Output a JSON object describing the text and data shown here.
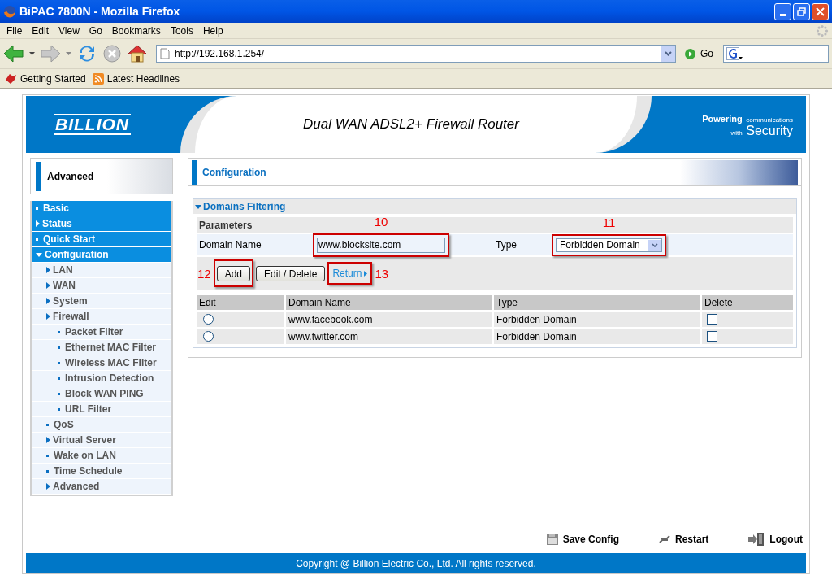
{
  "window": {
    "title": "BiPAC 7800N - Mozilla Firefox"
  },
  "menu": [
    "File",
    "Edit",
    "View",
    "Go",
    "Bookmarks",
    "Tools",
    "Help"
  ],
  "toolbar": {
    "address": "http://192.168.1.254/",
    "go": "Go"
  },
  "bookmarks": [
    "Getting Started",
    "Latest Headlines"
  ],
  "header": {
    "logo": "BILLION",
    "product": "Dual WAN ADSL2+ Firewall Router",
    "tagline_top": "Powering",
    "tagline_small": "communications",
    "tagline_with": "with",
    "tagline_big": "Security"
  },
  "sidebar": {
    "title": "Advanced",
    "items": [
      {
        "label": "Basic",
        "kind": "page"
      },
      {
        "label": "Status",
        "kind": "folder",
        "expanded": false
      },
      {
        "label": "Quick Start",
        "kind": "page"
      },
      {
        "label": "Configuration",
        "kind": "folder",
        "expanded": true,
        "children": [
          {
            "label": "LAN",
            "kind": "folder",
            "expanded": false
          },
          {
            "label": "WAN",
            "kind": "folder",
            "expanded": false
          },
          {
            "label": "System",
            "kind": "folder",
            "expanded": false
          },
          {
            "label": "Firewall",
            "kind": "folder",
            "expanded": false,
            "children": [
              {
                "label": "Packet Filter",
                "kind": "page"
              },
              {
                "label": "Ethernet MAC Filter",
                "kind": "page"
              },
              {
                "label": "Wireless MAC Filter",
                "kind": "page"
              },
              {
                "label": "Intrusion Detection",
                "kind": "page"
              },
              {
                "label": "Block WAN PING",
                "kind": "page"
              },
              {
                "label": "URL Filter",
                "kind": "page"
              }
            ]
          },
          {
            "label": "QoS",
            "kind": "page"
          },
          {
            "label": "Virtual Server",
            "kind": "folder",
            "expanded": false
          },
          {
            "label": "Wake on LAN",
            "kind": "page"
          },
          {
            "label": "Time Schedule",
            "kind": "page"
          },
          {
            "label": "Advanced",
            "kind": "folder",
            "expanded": false
          }
        ]
      }
    ]
  },
  "panel": {
    "title": "Configuration",
    "section": {
      "title": "Domains Filtering",
      "expanded": true
    },
    "parameters_label": "Parameters",
    "fields": [
      {
        "kind": "text",
        "label": "Domain Name",
        "value": "www.blocksite.com",
        "callout": "10"
      },
      {
        "kind": "select",
        "label": "Type",
        "value": "Forbidden Domain",
        "callout": "11"
      }
    ],
    "buttons": [
      {
        "kind": "button",
        "label": "Add",
        "callout": "12"
      },
      {
        "kind": "button",
        "label": "Edit / Delete"
      },
      {
        "kind": "link",
        "label": "Return",
        "callout": "13"
      }
    ],
    "table": {
      "columns": [
        "Edit",
        "Domain Name",
        "Type",
        "Delete"
      ],
      "rows": [
        {
          "selected": false,
          "domain": "www.facebook.com",
          "type": "Forbidden Domain",
          "checked": false
        },
        {
          "selected": false,
          "domain": "www.twitter.com",
          "type": "Forbidden Domain",
          "checked": false
        }
      ]
    }
  },
  "actions": [
    {
      "kind": "save",
      "label": "Save Config"
    },
    {
      "kind": "restart",
      "label": "Restart"
    },
    {
      "kind": "logout",
      "label": "Logout"
    }
  ],
  "footer": "Copyright @ Billion Electric Co., Ltd. All rights reserved."
}
